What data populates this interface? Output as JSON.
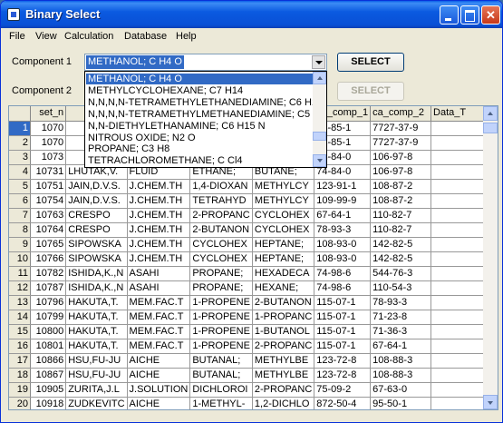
{
  "window": {
    "title": "Binary Select"
  },
  "menu": [
    "File",
    "View",
    "Calculation",
    "Database",
    "Help"
  ],
  "form": {
    "component1_label": "Component 1",
    "component2_label": "Component 2",
    "component1_value": "METHANOL; C H4 O",
    "select1_label": "SELECT",
    "select2_label": "SELECT"
  },
  "dropdown": {
    "items": [
      "METHANOL; C H4 O",
      "METHYLCYCLOHEXANE; C7 H14",
      "N,N,N,N-TETRAMETHYLETHANEDIAMINE; C6 H1",
      "N,N,N,N-TETRAMETHYLMETHANEDIAMINE; C5 H",
      "N,N-DIETHYLETHANAMINE; C6 H15 N",
      "NITROUS OXIDE; N2 O",
      "PROPANE; C3 H8",
      "TETRACHLOROMETHANE; C Cl4"
    ],
    "selected_index": 0
  },
  "grid": {
    "headers": [
      "",
      "set_n",
      "",
      "",
      "",
      "",
      "ca_comp_1",
      "ca_comp_2",
      "Data_T"
    ],
    "rows": [
      [
        "1",
        "1070",
        "",
        "",
        "",
        "",
        "74-85-1",
        "7727-37-9",
        ""
      ],
      [
        "2",
        "1070",
        "",
        "",
        "",
        "",
        "74-85-1",
        "7727-37-9",
        ""
      ],
      [
        "3",
        "1073",
        "",
        "",
        "",
        "",
        "74-84-0",
        "106-97-8",
        ""
      ],
      [
        "4",
        "10731",
        "LHUTAK,V.",
        "FLUID",
        "ETHANE;",
        "BUTANE;",
        "74-84-0",
        "106-97-8",
        ""
      ],
      [
        "5",
        "10751",
        "JAIN,D.V.S.",
        "J.CHEM.TH",
        "1,4-DIOXAN",
        "METHYLCY",
        "123-91-1",
        "108-87-2",
        ""
      ],
      [
        "6",
        "10754",
        "JAIN,D.V.S.",
        "J.CHEM.TH",
        "TETRAHYD",
        "METHYLCY",
        "109-99-9",
        "108-87-2",
        ""
      ],
      [
        "7",
        "10763",
        "CRESPO",
        "J.CHEM.TH",
        "2-PROPANC",
        "CYCLOHEX",
        "67-64-1",
        "110-82-7",
        ""
      ],
      [
        "8",
        "10764",
        "CRESPO",
        "J.CHEM.TH",
        "2-BUTANON",
        "CYCLOHEX",
        "78-93-3",
        "110-82-7",
        ""
      ],
      [
        "9",
        "10765",
        "SIPOWSKA",
        "J.CHEM.TH",
        "CYCLOHEX",
        "HEPTANE;",
        "108-93-0",
        "142-82-5",
        ""
      ],
      [
        "10",
        "10766",
        "SIPOWSKA",
        "J.CHEM.TH",
        "CYCLOHEX",
        "HEPTANE;",
        "108-93-0",
        "142-82-5",
        ""
      ],
      [
        "11",
        "10782",
        "ISHIDA,K.,N",
        "ASAHI",
        "PROPANE;",
        "HEXADECA",
        "74-98-6",
        "544-76-3",
        ""
      ],
      [
        "12",
        "10787",
        "ISHIDA,K.,N",
        "ASAHI",
        "PROPANE;",
        "HEXANE;",
        "74-98-6",
        "110-54-3",
        ""
      ],
      [
        "13",
        "10796",
        "HAKUTA,T.",
        "MEM.FAC.T",
        "1-PROPENE",
        "2-BUTANON",
        "115-07-1",
        "78-93-3",
        ""
      ],
      [
        "14",
        "10799",
        "HAKUTA,T.",
        "MEM.FAC.T",
        "1-PROPENE",
        "1-PROPANC",
        "115-07-1",
        "71-23-8",
        ""
      ],
      [
        "15",
        "10800",
        "HAKUTA,T.",
        "MEM.FAC.T",
        "1-PROPENE",
        "1-BUTANOL",
        "115-07-1",
        "71-36-3",
        ""
      ],
      [
        "16",
        "10801",
        "HAKUTA,T.",
        "MEM.FAC.T",
        "1-PROPENE",
        "2-PROPANC",
        "115-07-1",
        "67-64-1",
        ""
      ],
      [
        "17",
        "10866",
        "HSU,FU-JU",
        "AICHE",
        "BUTANAL;",
        "METHYLBE",
        "123-72-8",
        "108-88-3",
        ""
      ],
      [
        "18",
        "10867",
        "HSU,FU-JU",
        "AICHE",
        "BUTANAL;",
        "METHYLBE",
        "123-72-8",
        "108-88-3",
        ""
      ],
      [
        "19",
        "10905",
        "ZURITA,J.L",
        "J.SOLUTION",
        "DICHLOROI",
        "2-PROPANC",
        "75-09-2",
        "67-63-0",
        ""
      ],
      [
        "20",
        "10918",
        "ZUDKEVITC",
        "AICHE",
        "1-METHYL-",
        "1,2-DICHLO",
        "872-50-4",
        "95-50-1",
        ""
      ]
    ],
    "current_row": 0
  }
}
